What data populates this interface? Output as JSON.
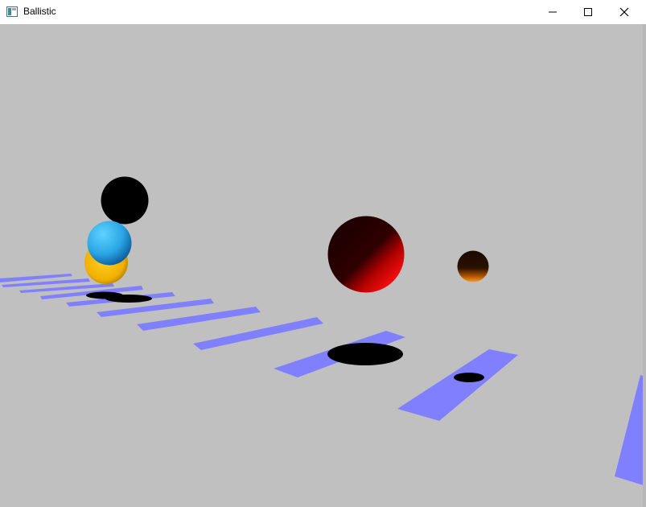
{
  "window": {
    "title": "Ballistic",
    "icon": "window-app-icon",
    "controls": [
      "minimize-icon",
      "maximize-icon",
      "close-icon"
    ]
  },
  "scene": {
    "background": "#c0c0c0",
    "ground_tile_color": "#8080ff",
    "shadow_color": "#000000",
    "spheres": [
      {
        "name": "black-sphere",
        "color": "#000000"
      },
      {
        "name": "cyan-sphere",
        "color": "#33aaee"
      },
      {
        "name": "yellow-sphere",
        "color": "#f0b400"
      },
      {
        "name": "red-sphere",
        "color": "#ff0000"
      },
      {
        "name": "orange-sphere",
        "color": "#e07800"
      }
    ]
  }
}
